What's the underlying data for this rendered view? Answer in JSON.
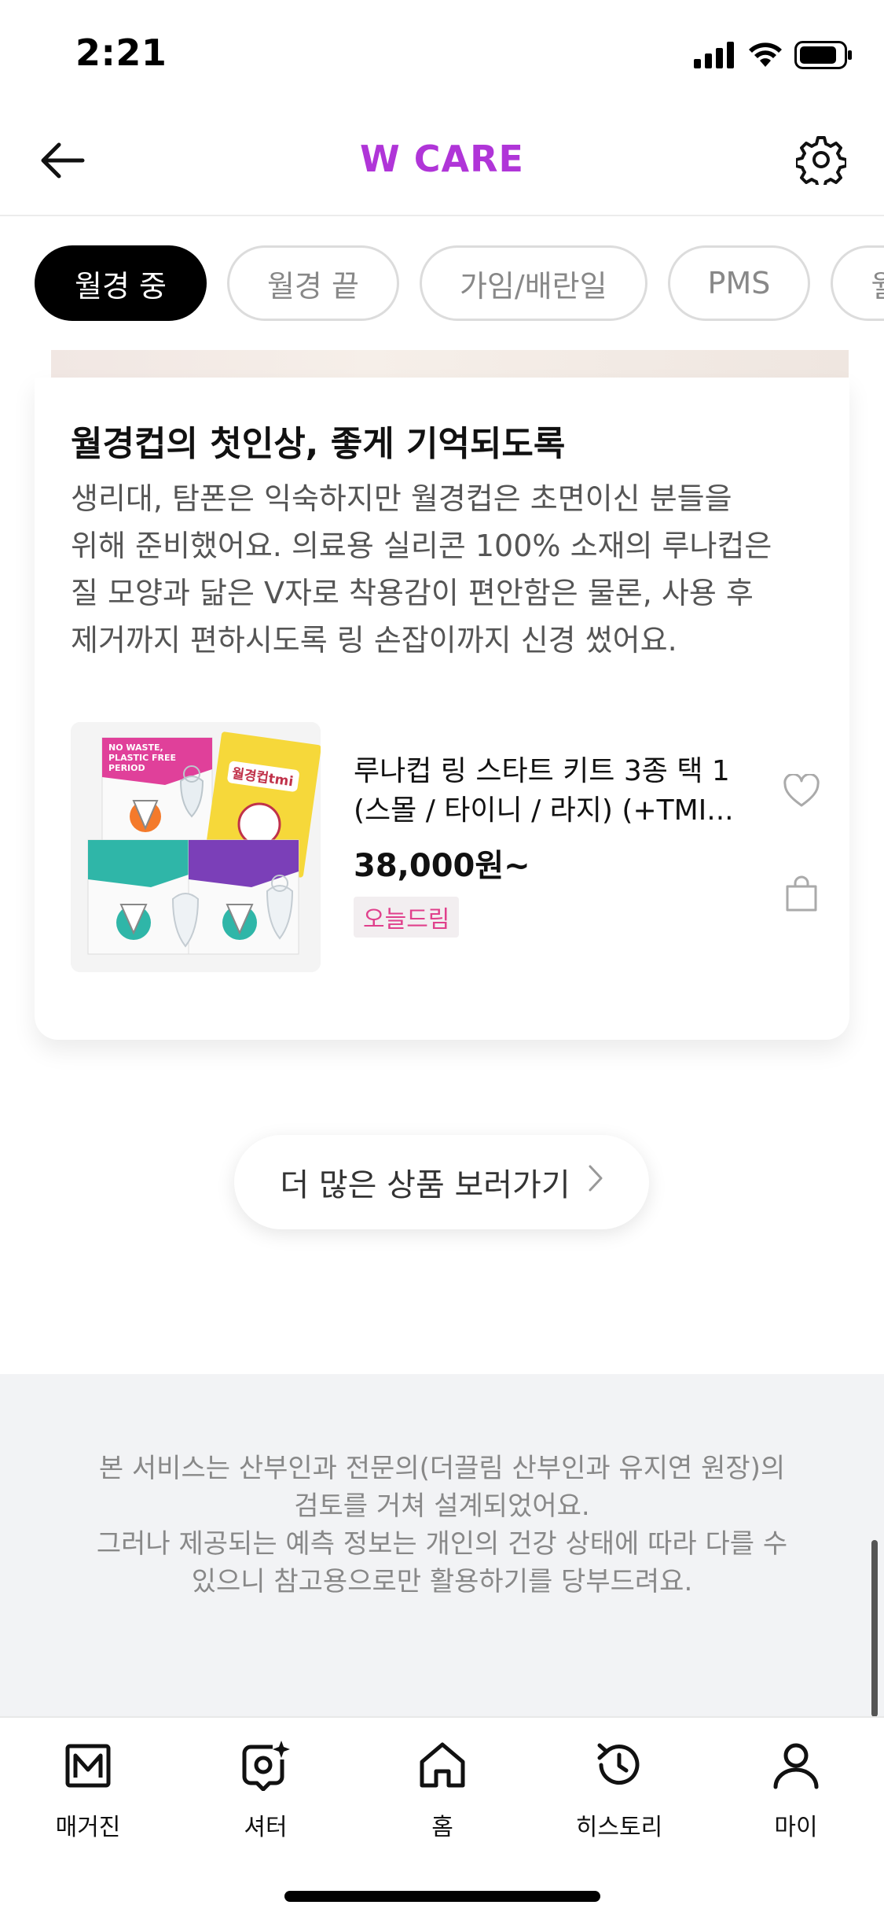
{
  "status_bar": {
    "time": "2:21",
    "icons": [
      "signal-icon",
      "wifi-icon",
      "battery-icon"
    ]
  },
  "header": {
    "title": "W CARE",
    "back_icon": "arrow-left-icon",
    "settings_icon": "gear-icon",
    "title_color": "#b035d8"
  },
  "chips": [
    {
      "label": "월경 중",
      "active": true
    },
    {
      "label": "월경 끝",
      "active": false
    },
    {
      "label": "가임/배란일",
      "active": false
    },
    {
      "label": "PMS",
      "active": false
    },
    {
      "label": "월경",
      "active": false
    }
  ],
  "card": {
    "title": "월경컵의 첫인상, 좋게 기억되도록",
    "description_lines": [
      "생리대, 탐폰은 익숙하지만 월경컵은 초면이신 분들을",
      "위해 준비했어요. 의료용 실리콘 100% 소재의 루나컵은",
      "질 모양과 닮은 V자로 착용감이 편안함은 물론, 사용 후",
      "제거까지 편하시도록 링 손잡이까지 신경 썼어요."
    ],
    "product": {
      "name_lines": [
        "루나컵 링 스타트 키트 3종 택 1",
        "(스몰 / 타이니 / 라지) (+TMI..."
      ],
      "price": "38,000원~",
      "badge": "오늘드림",
      "badge_color": "#e0408c",
      "thumb_texts": {
        "box_line1": "NO WASTE,",
        "box_line2": "PLASTIC FREE",
        "box_line3": "PERIOD",
        "book_title": "월경컵tmi"
      }
    }
  },
  "more_button": {
    "label": "더 많은 상품 보러가기"
  },
  "notice": {
    "lines": [
      "본 서비스는 산부인과 전문의(더끌림 산부인과 유지연 원장)의",
      "검토를 거쳐 설계되었어요.",
      "그러나 제공되는 예측 정보는 개인의 건강 상태에 따라 다를 수",
      "있으니 참고용으로만 활용하기를 당부드려요."
    ]
  },
  "bottom_nav": [
    {
      "label": "매거진",
      "icon": "magazine-icon"
    },
    {
      "label": "셔터",
      "icon": "camera-sparkle-icon"
    },
    {
      "label": "홈",
      "icon": "home-icon"
    },
    {
      "label": "히스토리",
      "icon": "history-icon"
    },
    {
      "label": "마이",
      "icon": "profile-icon"
    }
  ]
}
